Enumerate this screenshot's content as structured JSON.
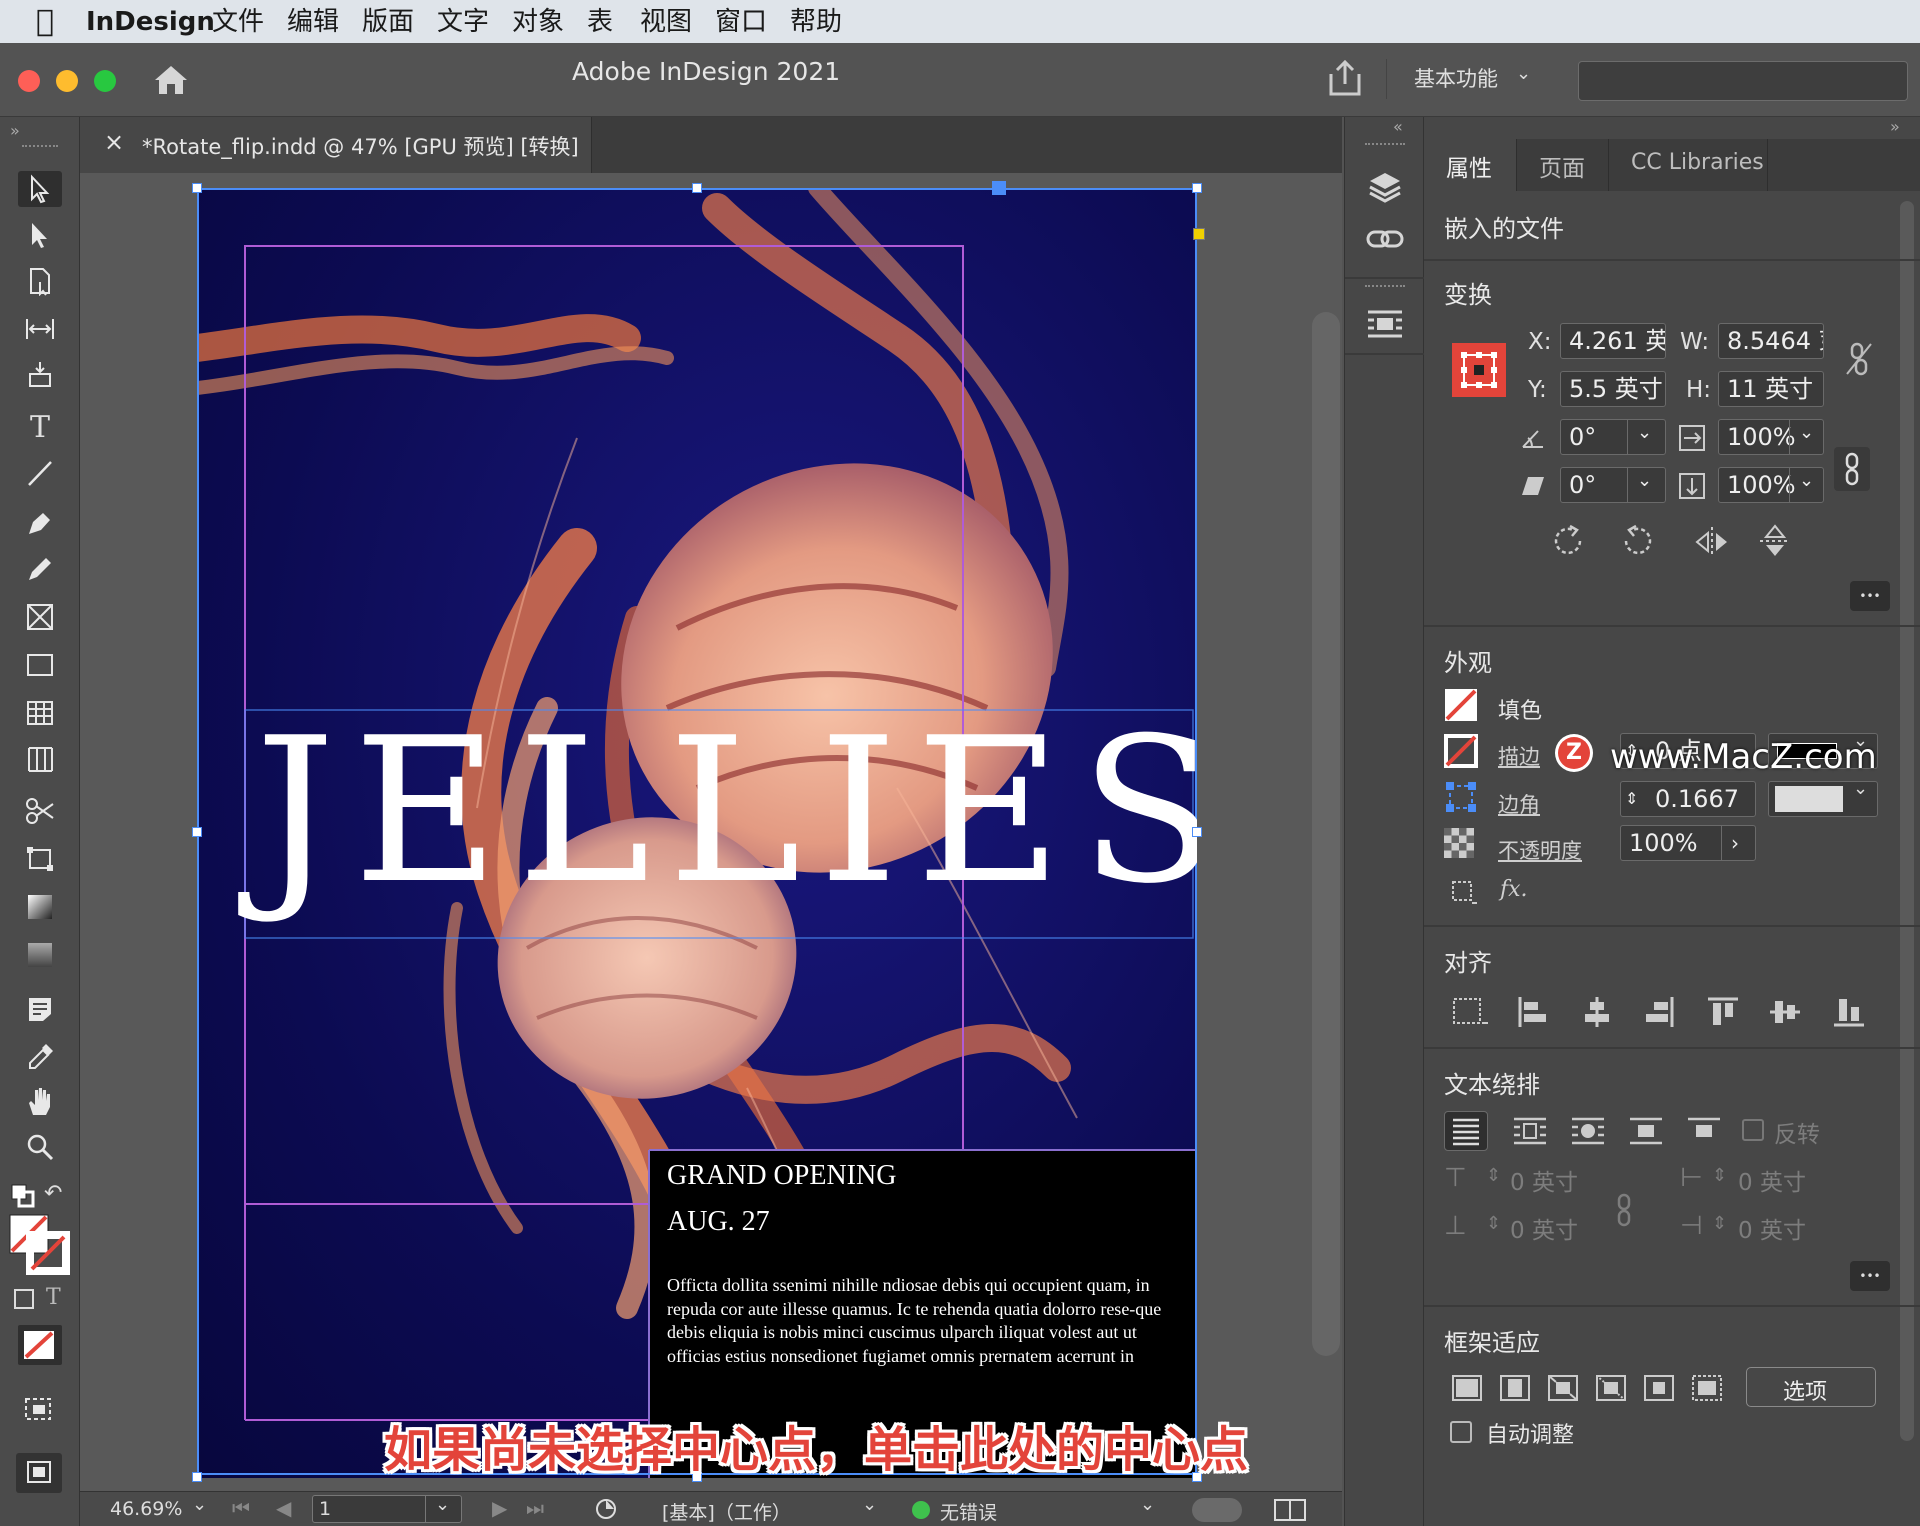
{
  "menubar": {
    "apple_icon": "apple-logo",
    "app_name": "InDesign",
    "items": [
      "文件",
      "编辑",
      "版面",
      "文字",
      "对象",
      "表",
      "视图",
      "窗口",
      "帮助"
    ]
  },
  "titlebar": {
    "title": "Adobe InDesign 2021",
    "workspace_label": "基本功能",
    "search_placeholder": ""
  },
  "document_tab": {
    "close_glyph": "×",
    "label": "*Rotate_flip.indd @ 47% [GPU 预览] [转换]"
  },
  "artwork": {
    "headline": "JELLIES",
    "line1": "GRAND OPENING",
    "line2": "AUG. 27",
    "body": "Officta dollita ssenimi nihille ndiosae debis qui occupient quam, in repuda cor aute illesse quamus. Ic te rehenda quatia dolorro rese-que debis eliquia is nobis minci cuscimus ulparch iliquat volest aut ut officias estius nonsedionet fugiamet omnis prernatem acerrunt in"
  },
  "caption": "如果尚未选择中心点，单击此处的中心点",
  "statusbar": {
    "zoom": "46.69%",
    "page_number": "1",
    "layout": "[基本]（工作）",
    "error_status": "无错误"
  },
  "panel": {
    "tabs": [
      "属性",
      "页面",
      "CC Libraries"
    ],
    "embedded_file": "嵌入的文件",
    "transform": {
      "title": "变换",
      "x_label": "X:",
      "x_value": "4.261 英",
      "w_label": "W:",
      "w_value": "8.5464 芽",
      "y_label": "Y:",
      "y_value": "5.5 英寸",
      "h_label": "H:",
      "h_value": "11 英寸",
      "rotation_value": "0°",
      "shear_value": "0°",
      "scale_x_value": "100%",
      "scale_y_value": "100%"
    },
    "appearance": {
      "title": "外观",
      "fill_label": "填色",
      "stroke_label": "描边",
      "stroke_value": "0 点",
      "corner_label": "边角",
      "corner_value": "0.1667",
      "opacity_label": "不透明度",
      "opacity_value": "100%",
      "fx_label": "fx."
    },
    "watermark": "www.MacZ.com",
    "align_title": "对齐",
    "text_wrap": {
      "title": "文本绕排",
      "invert_label": "反转",
      "top_offset": "0 英寸",
      "bottom_offset": "0 英寸",
      "left_offset": "0 英寸",
      "right_offset": "0 英寸"
    },
    "frame_fitting": {
      "title": "框架适应",
      "options_button": "选项",
      "auto_fit_label": "自动调整"
    },
    "more_glyph": "•••"
  },
  "colors": {
    "accent_red": "#e3443a",
    "selection_blue": "#4b8df8",
    "page_bg": "#0c0b52",
    "jelly_orange": "#e8784a",
    "status_green": "#3fc24d"
  }
}
